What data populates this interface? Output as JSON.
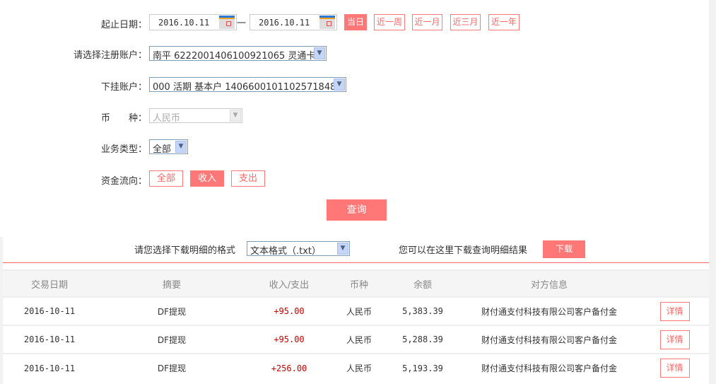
{
  "form": {
    "date_label": "起止日期：",
    "start_date": "2016.10.11",
    "end_date": "2016.10.11",
    "date_sep": "一",
    "quick_ranges": [
      {
        "label": "当日",
        "active": true
      },
      {
        "label": "近一周"
      },
      {
        "label": "近一月"
      },
      {
        "label": "近三月"
      },
      {
        "label": "近一年"
      }
    ],
    "reg_account_label": "请选择注册账户：",
    "reg_account_value": "南平  6222001406100921065  灵通卡",
    "sub_account_label": "下挂账户：",
    "sub_account_value": "000  活期  基本户  1406600101102571848",
    "currency_label": "币　　种：",
    "currency_value": "人民币",
    "biz_type_label": "业务类型：",
    "biz_type_value": "全部",
    "flow_label": "资金流向：",
    "flows": [
      {
        "label": "全部"
      },
      {
        "label": "收入",
        "active": true
      },
      {
        "label": "支出"
      }
    ],
    "query_label": "查询"
  },
  "download": {
    "format_label": "请您选择下载明细的格式",
    "format_value": "文本格式（.txt）",
    "hint": "您可以在这里下载查询明细结果",
    "button": "下载"
  },
  "table": {
    "headers": [
      "交易日期",
      "摘要",
      "收入/支出",
      "币种",
      "余额",
      "对方信息",
      ""
    ],
    "rows": [
      {
        "date": "2016-10-11",
        "summary": "DF提现",
        "amount": "+95.00",
        "currency": "人民币",
        "balance": "5,383.39",
        "counterparty": "财付通支付科技有限公司客户备付金",
        "action": "详情"
      },
      {
        "date": "2016-10-11",
        "summary": "DF提现",
        "amount": "+95.00",
        "currency": "人民币",
        "balance": "5,288.39",
        "counterparty": "财付通支付科技有限公司客户备付金",
        "action": "详情"
      },
      {
        "date": "2016-10-11",
        "summary": "DF提现",
        "amount": "+256.00",
        "currency": "人民币",
        "balance": "5,193.39",
        "counterparty": "财付通支付科技有限公司客户备付金",
        "action": "详情"
      }
    ]
  },
  "colors": {
    "accent": "#ff7777",
    "amount": "#cc0000"
  }
}
